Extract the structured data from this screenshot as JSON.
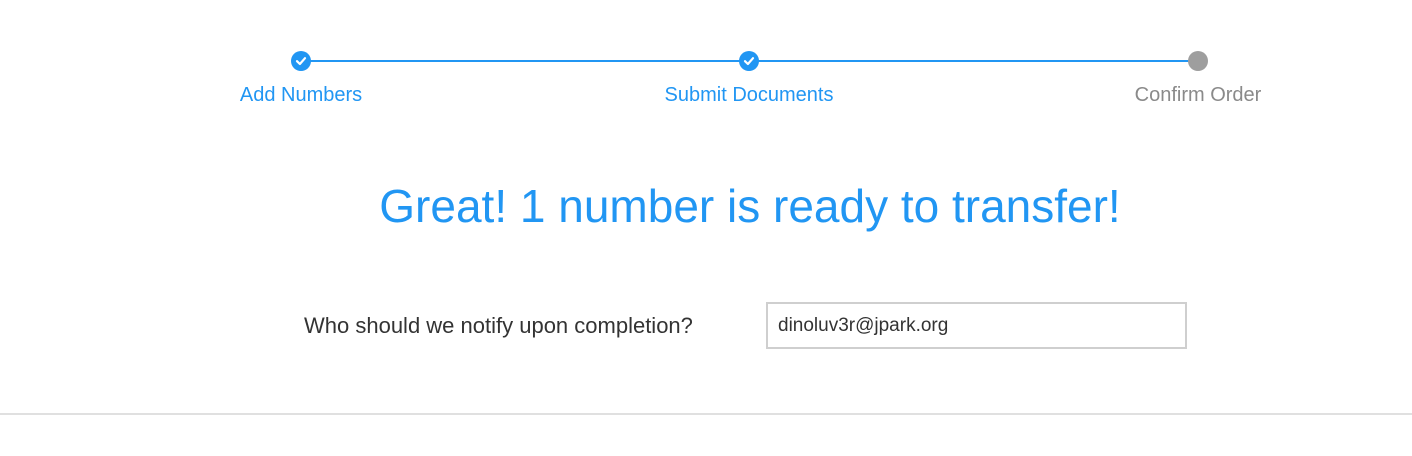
{
  "stepper": {
    "steps": [
      {
        "label": "Add Numbers",
        "state": "completed"
      },
      {
        "label": "Submit Documents",
        "state": "completed"
      },
      {
        "label": "Confirm Order",
        "state": "current"
      }
    ],
    "completed_color": "#2196f3",
    "current_color": "#9e9e9e",
    "completed_icon": "check-icon"
  },
  "headline": "Great! 1 number is ready to transfer!",
  "notify": {
    "label": "Who should we notify upon completion?",
    "value": "dinoluv3r@jpark.org"
  }
}
